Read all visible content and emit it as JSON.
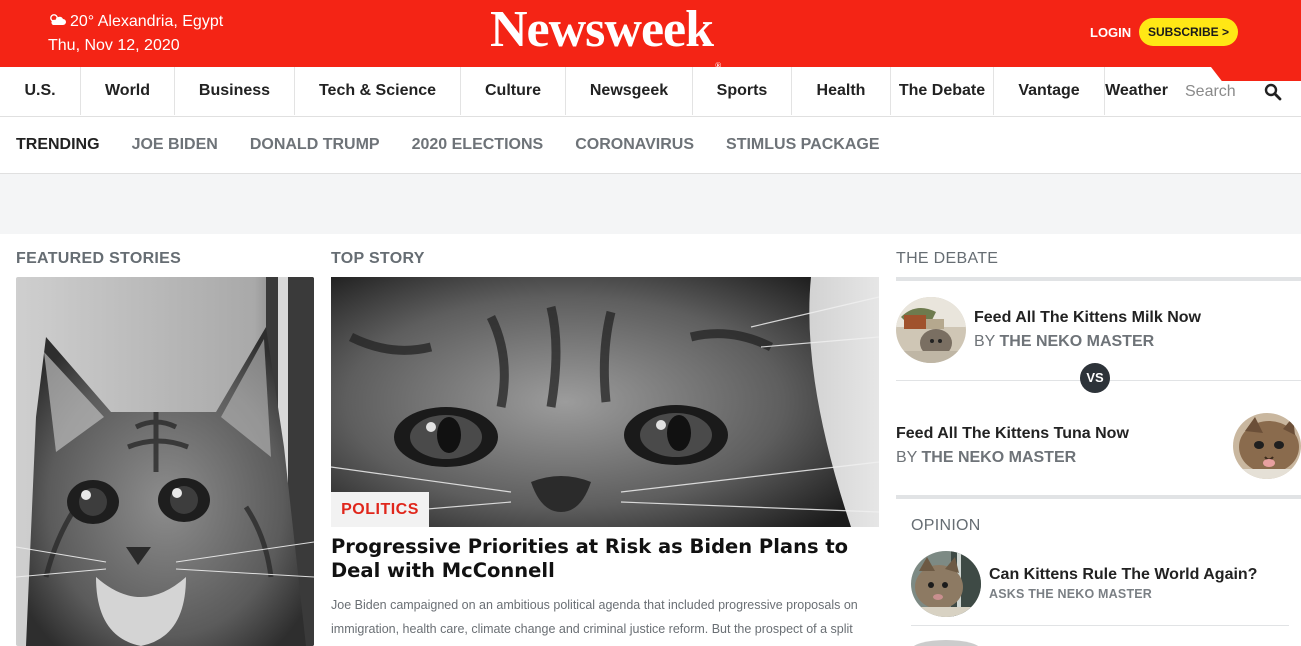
{
  "header": {
    "weather_temp_location": "20° Alexandria, Egypt",
    "date": "Thu, Nov 12, 2020",
    "logo": "Newsweek",
    "logo_mark": "®",
    "login": "LOGIN",
    "subscribe": "SUBSCRIBE >",
    "brand_color": "#f42415",
    "subscribe_color": "#ffe715"
  },
  "nav": {
    "items": [
      "U.S.",
      "World",
      "Business",
      "Tech & Science",
      "Culture",
      "Newsgeek",
      "Sports",
      "Health",
      "The Debate",
      "Vantage",
      "Weather"
    ],
    "search_placeholder": "Search",
    "search_icon": "search-icon"
  },
  "trending": {
    "label": "TRENDING",
    "items": [
      "JOE BIDEN",
      "DONALD TRUMP",
      "2020 ELECTIONS",
      "CORONAVIRUS",
      "STIMLUS PACKAGE"
    ]
  },
  "featured": {
    "heading": "FEATURED STORIES"
  },
  "top_story": {
    "heading": "TOP STORY",
    "tag": "POLITICS",
    "tag_color": "#e0261b",
    "headline": "Progressive Priorities at Risk as Biden Plans to Deal with McConnell",
    "summary": "Joe Biden campaigned on an ambitious political agenda that included progressive proposals on immigration, health care, climate change and criminal justice reform. But the prospect of a split"
  },
  "debate": {
    "heading": "THE DEBATE",
    "vs": "VS",
    "side_a": {
      "title": "Feed All The Kittens Milk Now",
      "by": "BY ",
      "author": "THE NEKO MASTER"
    },
    "side_b": {
      "title": "Feed All The Kittens Tuna Now",
      "by": "BY ",
      "author": "THE NEKO MASTER"
    }
  },
  "opinion": {
    "heading": "OPINION",
    "items": [
      {
        "title": "Can Kittens Rule The World Again?",
        "by": "ASKS THE NEKO MASTER"
      }
    ]
  }
}
